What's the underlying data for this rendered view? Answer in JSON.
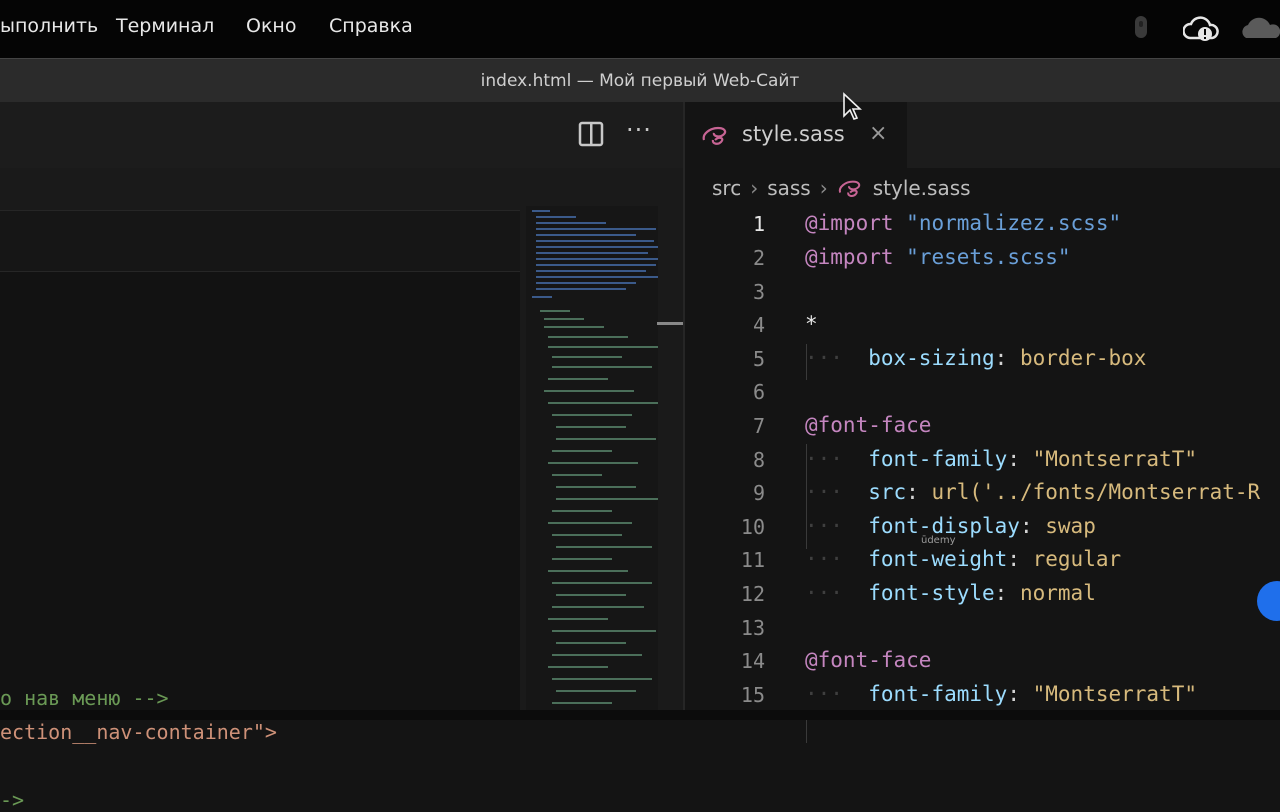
{
  "menubar": {
    "items": [
      "ыполнить",
      "Терминал",
      "Окно",
      "Справка"
    ],
    "icons": [
      "mic-icon",
      "cloud-sync-icon",
      "cloud-icon"
    ]
  },
  "window": {
    "title": "index.html — Мой первый Web-Сайт"
  },
  "left_editor": {
    "toolbar": {
      "split_icon": "split-editor-icon",
      "more_icon": "more-actions-icon",
      "more_label": "···"
    },
    "code_lines": [
      {
        "text": "о нав меню -->",
        "color": "#6a9955"
      },
      {
        "text": "ection__nav-container\">",
        "color": "#ce9178"
      },
      {
        "text": "->",
        "color": "#6a9955"
      }
    ]
  },
  "right_editor": {
    "tab": {
      "label": "style.sass",
      "icon": "sass-icon",
      "close_label": "×"
    },
    "breadcrumb": [
      "src",
      "sass",
      "style.sass"
    ],
    "breadcrumb_sep": "›",
    "line_numbers": [
      "1",
      "2",
      "3",
      "4",
      "5",
      "6",
      "7",
      "8",
      "9",
      "10",
      "11",
      "12",
      "13",
      "14",
      "15"
    ],
    "active_line": "1",
    "lines": {
      "l1_at": "@import",
      "l1_str": "\"normalizez.scss\"",
      "l2_at": "@import",
      "l2_str": "\"resets.scss\"",
      "l4_sel": "*",
      "l5_prop": "box-sizing",
      "l5_val": "border-box",
      "l7_at": "@font-face",
      "l8_prop": "font-family",
      "l8_val": "\"MontserratT\"",
      "l9_prop": "src",
      "l9_val": "url('../fonts/Montserrat-R",
      "l10_prop": "font-display",
      "l10_val": "swap",
      "l11_prop": "font-weight",
      "l11_val": "regular",
      "l12_prop": "font-style",
      "l12_val": "normal",
      "l14_at": "@font-face",
      "l15_prop": "font-family",
      "l15_val": "\"MontserratT\""
    },
    "indent_dots": "···",
    "colon": ":"
  },
  "watermark": "ūdemy",
  "colors": {
    "at_rule": "#c586c0",
    "string": "#ce9178",
    "property": "#9cdcfe",
    "value": "#d7ba7d"
  }
}
